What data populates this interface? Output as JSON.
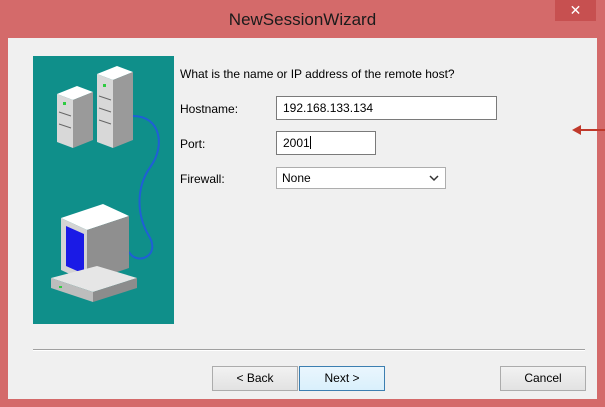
{
  "window": {
    "title": "NewSessionWizard",
    "close_glyph": "✕"
  },
  "prompt": "What is the name or IP address of the remote host?",
  "fields": {
    "hostname": {
      "label": "Hostname:",
      "value": "192.168.133.134"
    },
    "port": {
      "label": "Port:",
      "value": "2001"
    },
    "firewall": {
      "label": "Firewall:",
      "value": "None"
    }
  },
  "buttons": {
    "back": "< Back",
    "next": "Next >",
    "cancel": "Cancel"
  },
  "colors": {
    "title_bar": "#d46a6a",
    "illustration_bg": "#0f8f8a",
    "annotation_arrow": "#c0392b"
  },
  "icons": [
    "close-icon",
    "server-icon",
    "computer-icon",
    "cable-icon",
    "chevron-down-icon",
    "arrow-left-icon"
  ]
}
